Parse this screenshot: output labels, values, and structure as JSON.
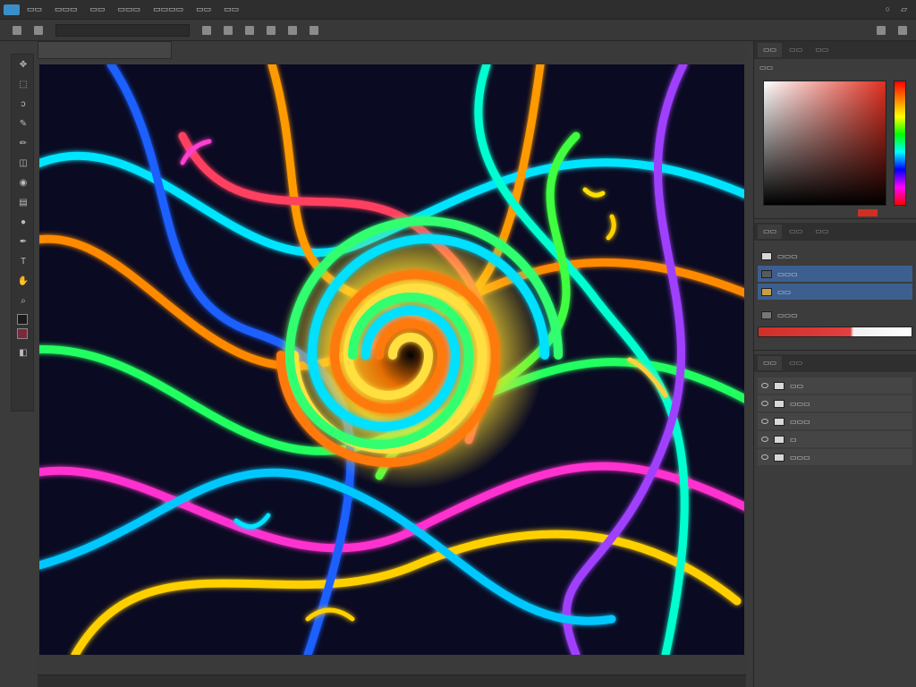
{
  "menubar": {
    "items": [
      "",
      "",
      "",
      "",
      "",
      "",
      ""
    ],
    "right_icons": [
      "minimize-icon",
      "restore-icon"
    ]
  },
  "optionsbar": {
    "preset_field": "",
    "buttons": [
      "",
      "",
      "",
      "",
      "",
      "",
      "",
      "",
      ""
    ]
  },
  "document": {
    "tab_title": "",
    "canvas_art": "neon-swirl-artwork"
  },
  "status": {
    "zoom": "",
    "info": ""
  },
  "color_panel": {
    "tabs": [
      "",
      "",
      ""
    ],
    "header": "",
    "current_color": "#d03020"
  },
  "adjustments_panel": {
    "tabs": [
      "",
      "",
      ""
    ],
    "rows": [
      {
        "label": ""
      },
      {
        "label": ""
      },
      {
        "label": ""
      },
      {
        "label": ""
      }
    ]
  },
  "layers_panel": {
    "tabs": [
      "",
      ""
    ],
    "layers": [
      {
        "name": "",
        "selected": false
      },
      {
        "name": "",
        "selected": false
      },
      {
        "name": "",
        "selected": false
      },
      {
        "name": "",
        "selected": false
      },
      {
        "name": "",
        "selected": false
      }
    ]
  },
  "colors": {
    "accent": "#3c5f8f",
    "foreground_swatch": "#1a1a1a",
    "background_swatch": "#7a2a3a"
  }
}
